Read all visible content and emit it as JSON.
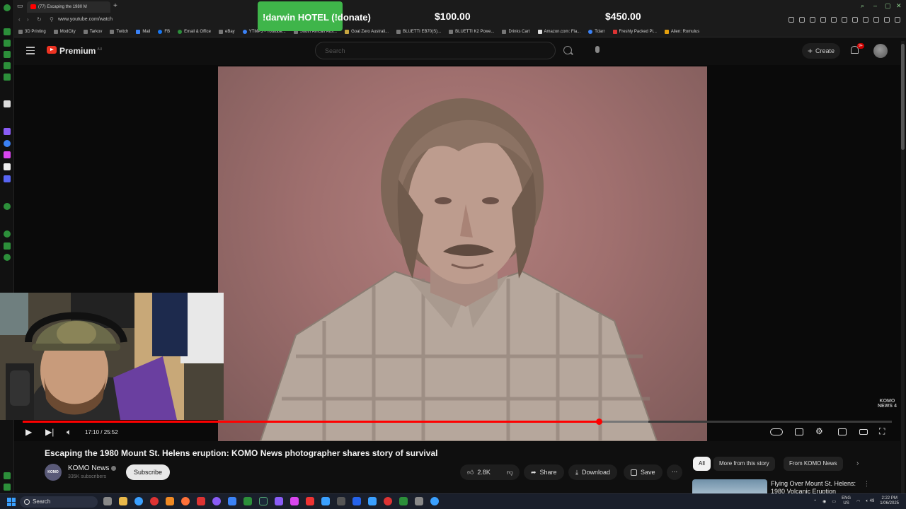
{
  "browser": {
    "tab_title": "(77) Escaping the 1980 M",
    "url": "www.youtube.com/watch",
    "bookmarks": [
      "3D Printing",
      "ModCity",
      "Tarkov",
      "Twitch",
      "Mail",
      "FB",
      "Email & Office",
      "eBay",
      "YTMP3 - Youtube...",
      "South African Aus...",
      "Goal Zero Australi...",
      "BLUETTI EB70(S)...",
      "BLUETTI K2 Powe...",
      "Drinks Cart",
      "Amazon.com: Fla...",
      "Tdarr",
      "Freshly Packed Pi...",
      "Alien: Romulus"
    ]
  },
  "overlay": {
    "donate_label": "!darwin HOTEL (!donate)",
    "amount_1": "$100.00",
    "amount_2": "$450.00",
    "banner_color": "#3fb54a"
  },
  "youtube": {
    "brand": "Premium",
    "brand_region": "AU",
    "search_placeholder": "Search",
    "create_label": "Create",
    "notification_count": "9+",
    "accent_color": "#ff0000"
  },
  "player": {
    "time_current": "17:10",
    "time_total": "25:52",
    "time_display": "17:10 / 25:52",
    "progress_fraction": 0.663,
    "buffered_fraction": 0.72,
    "watermark_line1": "KOMO",
    "watermark_line2": "NEWS 4"
  },
  "video": {
    "title": "Escaping the 1980 Mount St. Helens eruption: KOMO News photographer shares story of survival",
    "channel": "KOMO News",
    "channel_avatar_text": "KOMO",
    "subscribers": "335K subscribers",
    "subscribe_label": "Subscribe",
    "likes": "2.8K",
    "share_label": "Share",
    "download_label": "Download",
    "save_label": "Save",
    "more_label": "..."
  },
  "recommendations": {
    "chips": [
      "All",
      "More from this story",
      "From KOMO News"
    ],
    "active_chip": "All",
    "first_title_line1": "Flying Over Mount St. Helens:",
    "first_title_line2": "1980 Volcanic Eruption"
  },
  "taskbar": {
    "search_label": "Search",
    "lang_line1": "ENG",
    "lang_line2": "US",
    "volume": "49",
    "time": "2:22 PM",
    "date": "1/06/2025"
  }
}
